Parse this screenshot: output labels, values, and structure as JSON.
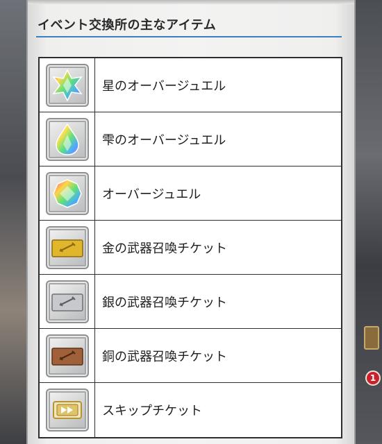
{
  "panel": {
    "title": "イベント交換所の主なアイテム"
  },
  "background": {
    "badge_count": "1"
  },
  "items": [
    {
      "name": "星のオーバージュエル",
      "icon": "star-over-jewel-icon"
    },
    {
      "name": "雫のオーバージュエル",
      "icon": "drop-over-jewel-icon"
    },
    {
      "name": "オーバージュエル",
      "icon": "over-jewel-icon"
    },
    {
      "name": "金の武器召喚チケット",
      "icon": "gold-weapon-summon-ticket-icon"
    },
    {
      "name": "銀の武器召喚チケット",
      "icon": "silver-weapon-summon-ticket-icon"
    },
    {
      "name": "銅の武器召喚チケット",
      "icon": "bronze-weapon-summon-ticket-icon"
    },
    {
      "name": "スキップチケット",
      "icon": "skip-ticket-icon"
    }
  ],
  "colors": {
    "title_rule": "#3a7fc3",
    "table_border": "#2d2d2d",
    "gold": "#e2b62c",
    "silver": "#c7c9cc",
    "bronze": "#a0603a"
  }
}
